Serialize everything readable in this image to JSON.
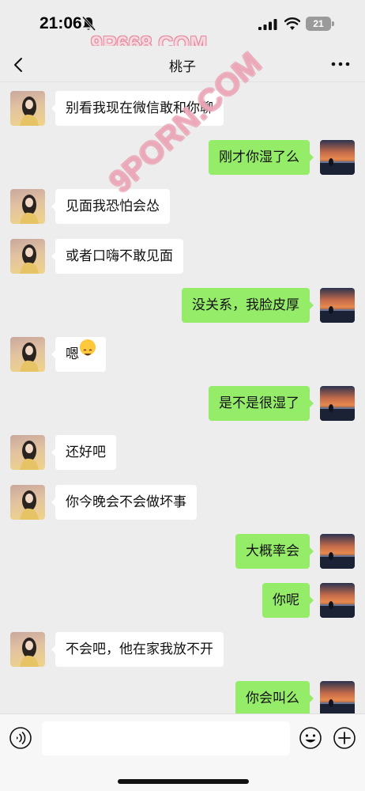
{
  "status_bar": {
    "time": "21:06",
    "battery": "21",
    "icons": [
      "bell-muted-icon",
      "signal-icon",
      "wifi-icon",
      "battery-icon"
    ]
  },
  "watermarks": {
    "top": "9P668.COM",
    "diagonal": "9PORN.COM"
  },
  "header": {
    "title": "桃子",
    "back_icon": "chevron-left-icon",
    "more_icon": "more-dots-icon"
  },
  "messages": [
    {
      "side": "in",
      "text": "别看我现在微信敢和你聊"
    },
    {
      "side": "out",
      "text": "刚才你湿了么"
    },
    {
      "side": "in",
      "text": "见面我恐怕会怂"
    },
    {
      "side": "in",
      "text": "或者口嗨不敢见面"
    },
    {
      "side": "out",
      "text": "没关系，我脸皮厚"
    },
    {
      "side": "in",
      "text": "嗯",
      "emoji": "grin-emoji"
    },
    {
      "side": "out",
      "text": "是不是很湿了"
    },
    {
      "side": "in",
      "text": "还好吧"
    },
    {
      "side": "in",
      "text": "你今晚会不会做坏事"
    },
    {
      "side": "out",
      "text": "大概率会"
    },
    {
      "side": "out",
      "text": "你呢"
    },
    {
      "side": "in",
      "text": "不会吧，他在家我放不开"
    },
    {
      "side": "out",
      "text": "你会叫么"
    }
  ],
  "input_bar": {
    "placeholder": "",
    "value": "",
    "icons": [
      "voice-icon",
      "emoji-icon",
      "plus-icon"
    ]
  },
  "colors": {
    "background": "#ededed",
    "bubble_in": "#ffffff",
    "bubble_out": "#95ec69",
    "watermark": "#e58aa0"
  }
}
